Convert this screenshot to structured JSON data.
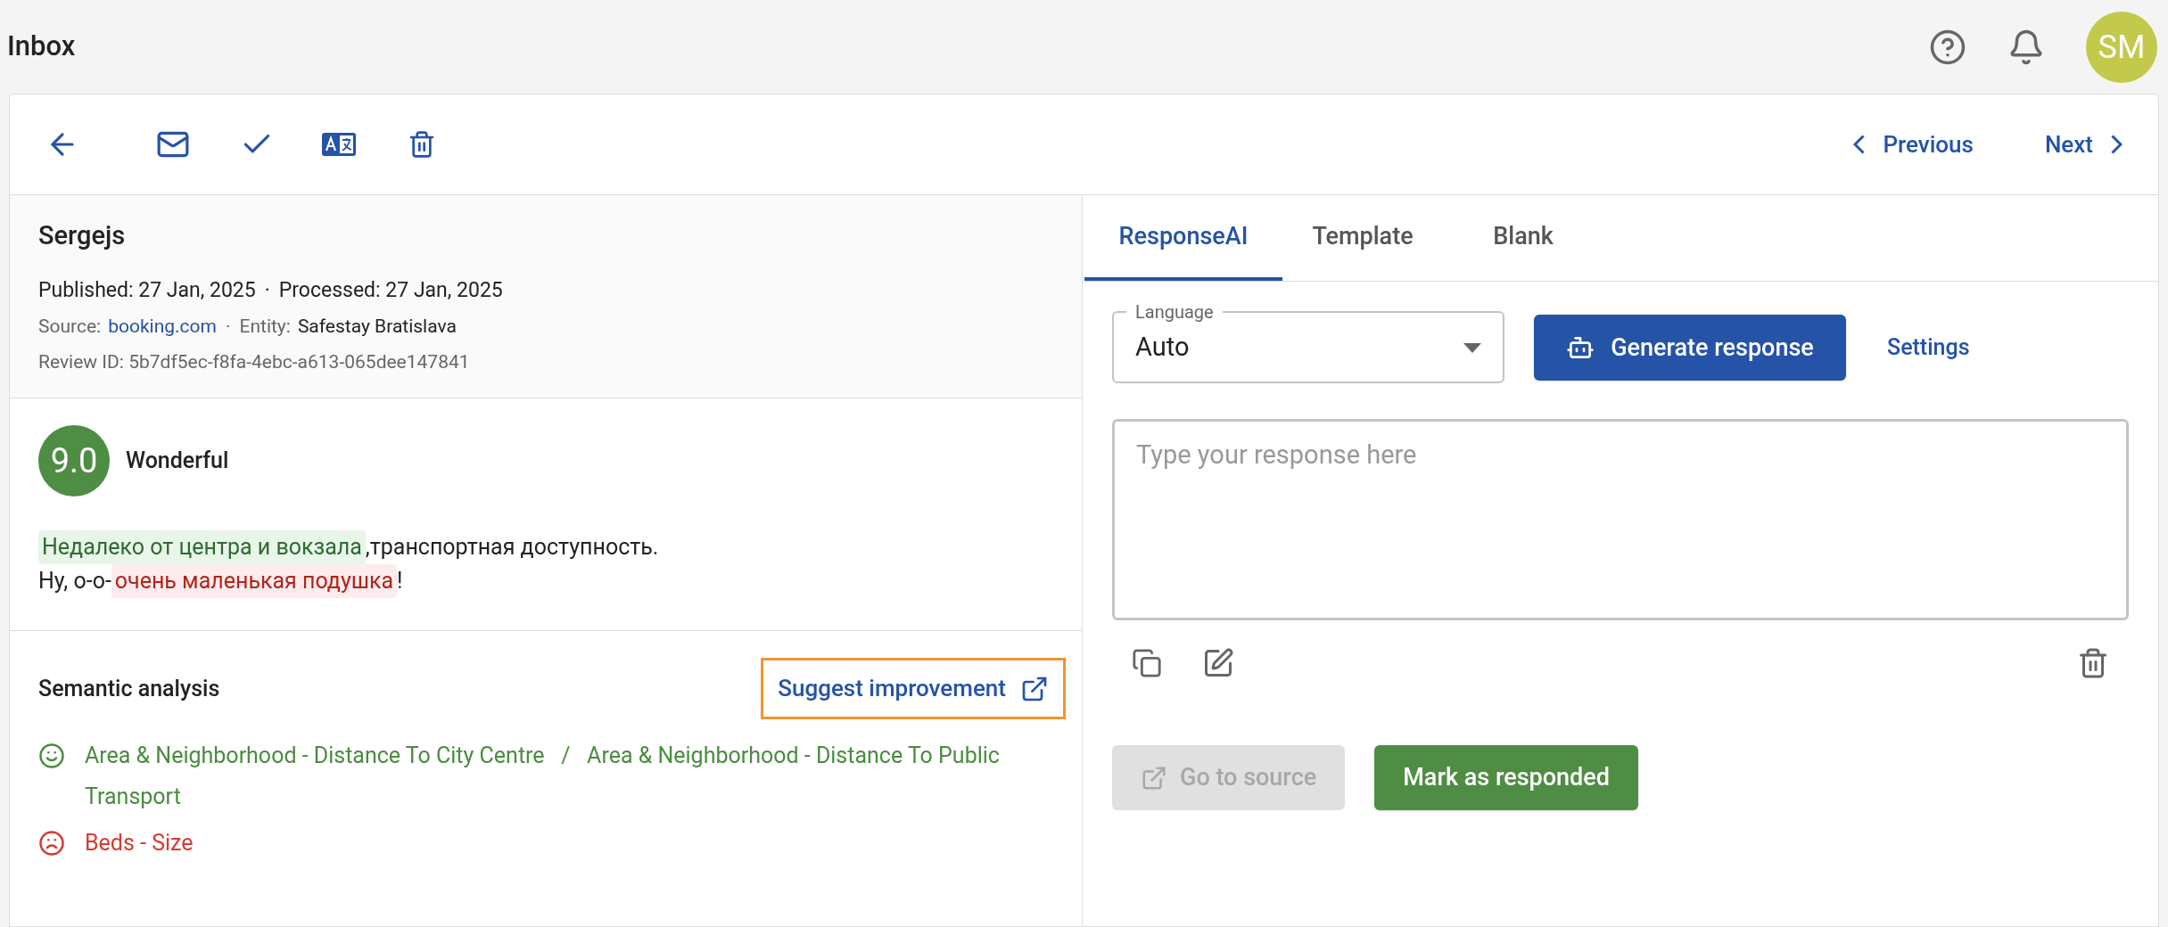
{
  "header": {
    "title": "Inbox",
    "avatar": "SM"
  },
  "nav": {
    "previous": "Previous",
    "next": "Next"
  },
  "review": {
    "author": "Sergejs",
    "separators": [
      "·",
      "·"
    ],
    "published_label": "Published:",
    "published": "27 Jan, 2025",
    "processed_label": "Processed:",
    "processed": "27 Jan, 2025",
    "source_label": "Source:",
    "source": "booking.com",
    "entity_label": "Entity:",
    "entity": "Safestay Bratislava",
    "review_id_label": "Review ID:",
    "review_id": "5b7df5ec-f8fa-4ebc-a613-065dee147841",
    "score": "9.0",
    "score_label": "Wonderful",
    "lines": [
      [
        {
          "text": "Недалеко от центра и вокзала",
          "kind": "positive"
        },
        {
          "text": ",транспортная доступность.",
          "kind": "plain"
        }
      ],
      [
        {
          "text": "Ну, о-о-",
          "kind": "plain"
        },
        {
          "text": "очень маленькая подушка",
          "kind": "negative"
        },
        {
          "text": "!",
          "kind": "plain"
        }
      ]
    ]
  },
  "semantic": {
    "title": "Semantic analysis",
    "suggest": "Suggest improvement",
    "separator": "/",
    "topics": [
      {
        "kind": "positive",
        "labels": [
          "Area & Neighborhood - Distance To City Centre",
          "Area & Neighborhood - Distance To Public Transport"
        ]
      },
      {
        "kind": "negative",
        "labels": [
          "Beds - Size"
        ]
      }
    ]
  },
  "tabs": [
    {
      "label": "ResponseAI",
      "selected": true
    },
    {
      "label": "Template",
      "selected": false
    },
    {
      "label": "Blank",
      "selected": false
    }
  ],
  "language": {
    "label": "Language",
    "value": "Auto"
  },
  "generate": "Generate response",
  "settings": "Settings",
  "response": {
    "placeholder": "Type your response here"
  },
  "actions": [
    {
      "label": "Go to source",
      "disabled": true
    },
    {
      "label": "Mark as responded",
      "disabled": false
    }
  ]
}
